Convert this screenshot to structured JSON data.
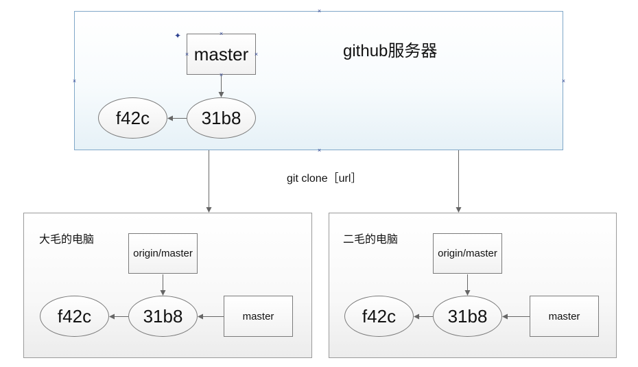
{
  "server": {
    "title": "github服务器",
    "branch_label": "master",
    "commit_new": "31b8",
    "commit_old": "f42c"
  },
  "clone_label": "git clone［url］",
  "computers": [
    {
      "title": "大毛的电脑",
      "remote_branch": "origin/master",
      "local_branch": "master",
      "commit_new": "31b8",
      "commit_old": "f42c"
    },
    {
      "title": "二毛的电脑",
      "remote_branch": "origin/master",
      "local_branch": "master",
      "commit_new": "31b8",
      "commit_old": "f42c"
    }
  ],
  "colors": {
    "server_border": "#7fa7c8",
    "server_fill_bottom": "#e6f1f7",
    "computer_border": "#9a9a9a",
    "line": "#666666",
    "selection_handle": "#2a3f8f"
  }
}
